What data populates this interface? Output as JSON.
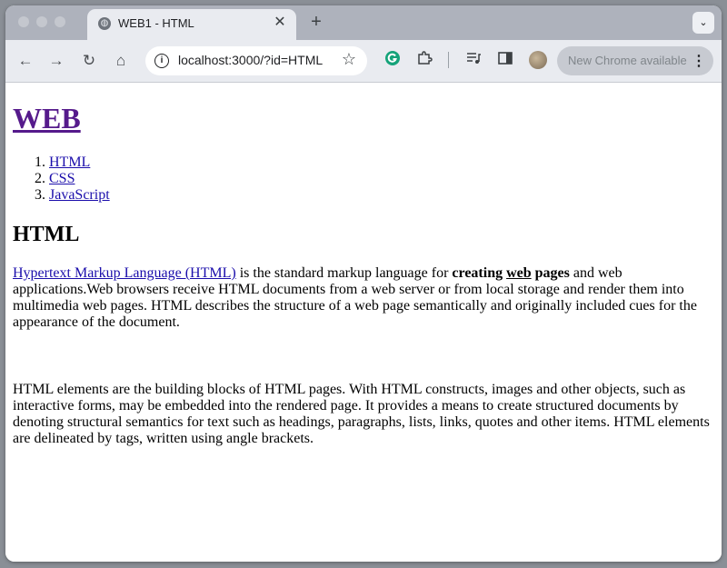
{
  "browser": {
    "tab": {
      "title": "WEB1 - HTML",
      "close_glyph": "✕"
    },
    "new_tab_glyph": "+",
    "tab_search_glyph": "⌄",
    "nav": {
      "back": "←",
      "forward": "→",
      "reload": "↻",
      "home": "⌂"
    },
    "omnibox": {
      "url": "localhost:3000/?id=HTML",
      "info_glyph": "i",
      "star_glyph": "☆"
    },
    "update_pill": {
      "label": "New Chrome available",
      "menu_glyph": "⋮"
    },
    "icons": [
      "site-info-icon",
      "bookmark-star-icon",
      "grammarly-extension-icon",
      "extensions-puzzle-icon",
      "media-controls-icon",
      "side-panel-icon",
      "profile-avatar"
    ]
  },
  "page": {
    "heading": "WEB",
    "nav_list": [
      "HTML",
      "CSS",
      "JavaScript"
    ],
    "title": "HTML",
    "paragraph1": {
      "link": "Hypertext Markup Language (HTML)",
      "text1": " is the standard markup language for ",
      "bold1": "creating",
      "space1": " ",
      "underline_bold": "web",
      "space2": " ",
      "bold2": "pages",
      "text2": " and web applications.Web browsers receive HTML documents from a web server or from local storage and render them into multimedia web pages. HTML describes the structure of a web page semantically and originally included cues for the appearance of the document."
    },
    "paragraph2": "HTML elements are the building blocks of HTML pages. With HTML constructs, images and other objects, such as interactive forms, may be embedded into the rendered page. It provides a means to create structured documents by denoting structural semantics for text such as headings, paragraphs, lists, links, quotes and other items. HTML elements are delineated by tags, written using angle brackets."
  }
}
